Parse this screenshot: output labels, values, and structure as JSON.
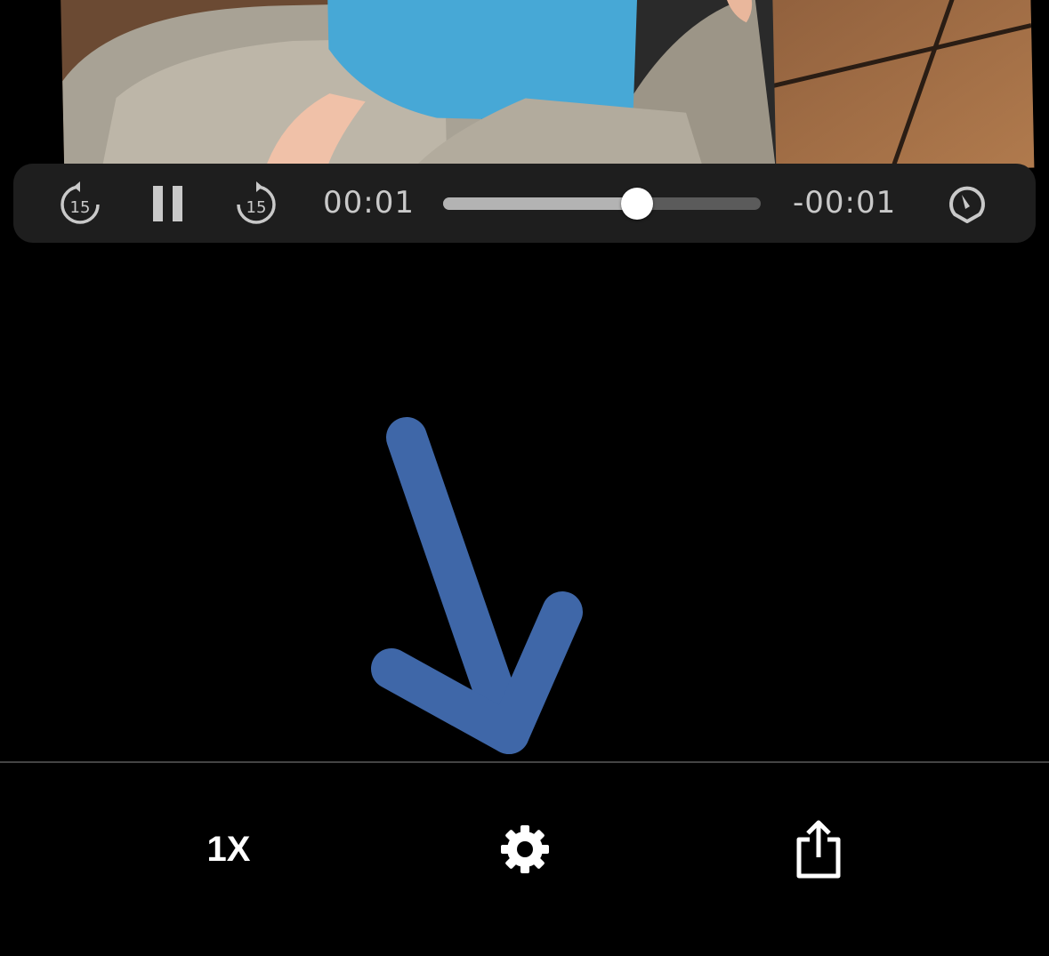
{
  "player": {
    "elapsed": "00:01",
    "remaining": "-00:01",
    "progress": 0.61,
    "skip_back_seconds": "15",
    "skip_forward_seconds": "15",
    "icons": {
      "skip_back": "rewind-15-icon",
      "play_pause": "pause-icon",
      "skip_forward": "forward-15-icon",
      "speed_dial": "playback-speed-icon"
    }
  },
  "toolbar": {
    "speed_label": "1X",
    "settings_icon": "gear-icon",
    "share_icon": "share-icon"
  },
  "annotation": {
    "color": "#3f67a8"
  }
}
